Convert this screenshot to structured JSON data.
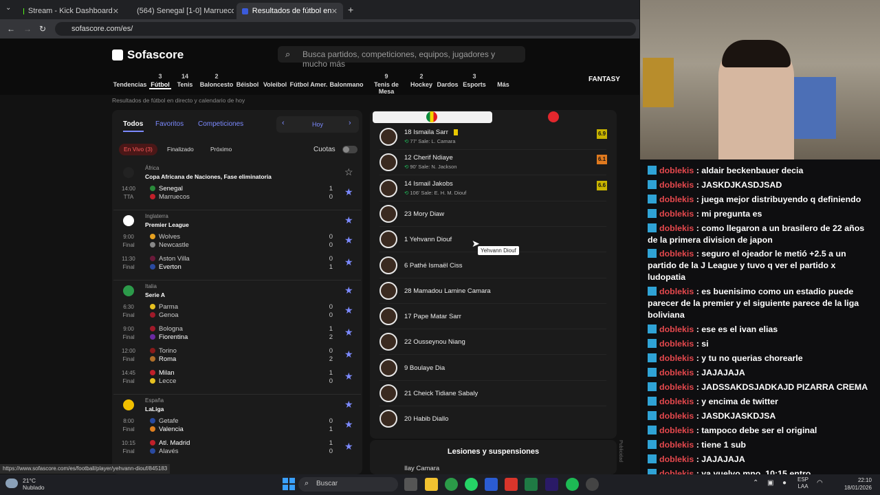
{
  "browser": {
    "tabs": [
      {
        "label": "Stream - Kick Dashboard"
      },
      {
        "label": "(564) Senegal [1-0] Marruecos |"
      },
      {
        "label": "Resultados de fútbol en directo"
      }
    ],
    "url": "sofascore.com/es/",
    "status_url": "https://www.sofascore.com/es/football/player/yehvann-diouf/845183"
  },
  "site": {
    "logo": "Sofascore",
    "search_placeholder": "Busca partidos, competiciones, equipos, jugadores y mucho más",
    "sports": [
      {
        "label": "Tendencias",
        "count": ""
      },
      {
        "label": "Fútbol",
        "count": "3"
      },
      {
        "label": "Tenis",
        "count": "14"
      },
      {
        "label": "Baloncesto",
        "count": "2"
      },
      {
        "label": "Béisbol",
        "count": ""
      },
      {
        "label": "Voleibol",
        "count": ""
      },
      {
        "label": "Fútbol Amer.",
        "count": ""
      },
      {
        "label": "Balonmano",
        "count": ""
      },
      {
        "label": "Tenis de Mesa",
        "count": "9"
      },
      {
        "label": "Hockey",
        "count": "2"
      },
      {
        "label": "Dardos",
        "count": ""
      },
      {
        "label": "Esports",
        "count": "3"
      },
      {
        "label": "Más",
        "count": ""
      }
    ],
    "fantasy": "FANTASY",
    "breadcrumb": "Resultados de fútbol en directo y calendario de hoy"
  },
  "left": {
    "tabs": [
      "Todos",
      "Favoritos",
      "Competiciones"
    ],
    "day": "Hoy",
    "filters": [
      "En Vivo (3)",
      "Finalizado",
      "Próximo"
    ],
    "odds_label": "Cuotas",
    "leagues": [
      {
        "region": "África",
        "name": "Copa Africana de Naciones, Fase eliminatoria",
        "matches": [
          {
            "time": "14:00",
            "status": "TTA",
            "home": "Senegal",
            "away": "Marruecos",
            "hs": "1",
            "as": "0"
          }
        ]
      },
      {
        "region": "Inglaterra",
        "name": "Premier League",
        "matches": [
          {
            "time": "9:00",
            "status": "Final",
            "home": "Wolves",
            "away": "Newcastle",
            "hs": "0",
            "as": "0"
          },
          {
            "time": "11:30",
            "status": "Final",
            "home": "Aston Villa",
            "away": "Everton",
            "hs": "0",
            "as": "1"
          }
        ]
      },
      {
        "region": "Italia",
        "name": "Serie A",
        "matches": [
          {
            "time": "6:30",
            "status": "Final",
            "home": "Parma",
            "away": "Genoa",
            "hs": "0",
            "as": "0"
          },
          {
            "time": "9:00",
            "status": "Final",
            "home": "Bologna",
            "away": "Fiorentina",
            "hs": "1",
            "as": "2"
          },
          {
            "time": "12:00",
            "status": "Final",
            "home": "Torino",
            "away": "Roma",
            "hs": "0",
            "as": "2"
          },
          {
            "time": "14:45",
            "status": "Final",
            "home": "Milan",
            "away": "Lecce",
            "hs": "1",
            "as": "0"
          }
        ]
      },
      {
        "region": "España",
        "name": "LaLiga",
        "matches": [
          {
            "time": "8:00",
            "status": "Final",
            "home": "Getafe",
            "away": "Valencia",
            "hs": "0",
            "as": "1"
          },
          {
            "time": "10:15",
            "status": "Final",
            "home": "Atl. Madrid",
            "away": "Alavés",
            "hs": "1",
            "as": "0"
          }
        ]
      }
    ]
  },
  "right": {
    "players": [
      {
        "name": "18 Ismaila Sarr",
        "sub": "77' Sale: L. Camara",
        "rating": "6.9",
        "rcolor": "#c9b400"
      },
      {
        "name": "12 Cherif Ndiaye",
        "sub": "90' Sale: N. Jackson",
        "rating": "6.1",
        "rcolor": "#e07a1f"
      },
      {
        "name": "14 Ismail Jakobs",
        "sub": "106' Sale: E. H. M. Diouf",
        "rating": "6.6",
        "rcolor": "#c9b400"
      },
      {
        "name": "23 Mory Diaw",
        "sub": "",
        "rating": "",
        "rcolor": ""
      },
      {
        "name": "1 Yehvann Diouf",
        "sub": "",
        "rating": "",
        "rcolor": ""
      },
      {
        "name": "6 Pathé Ismaël Ciss",
        "sub": "",
        "rating": "",
        "rcolor": ""
      },
      {
        "name": "28 Mamadou Lamine Camara",
        "sub": "",
        "rating": "",
        "rcolor": ""
      },
      {
        "name": "17 Pape Matar Sarr",
        "sub": "",
        "rating": "",
        "rcolor": ""
      },
      {
        "name": "22 Ousseynou Niang",
        "sub": "",
        "rating": "",
        "rcolor": ""
      },
      {
        "name": "9 Boulaye Dia",
        "sub": "",
        "rating": "",
        "rcolor": ""
      },
      {
        "name": "21 Cheick Tidiane Sabaly",
        "sub": "",
        "rating": "",
        "rcolor": ""
      },
      {
        "name": "20 Habib Diallo",
        "sub": "",
        "rating": "",
        "rcolor": ""
      }
    ],
    "tooltip": "Yehvann Diouf",
    "section": "Lesiones y suspensiones",
    "last": "Ilay Camara",
    "ad": "Publicidad"
  },
  "chat": [
    {
      "user": "doblekis",
      "text": "aldair beckenbauer decia"
    },
    {
      "user": "doblekis",
      "text": "JASKDJKASDJSAD"
    },
    {
      "user": "doblekis",
      "text": "juega mejor distribuyendo q definiendo"
    },
    {
      "user": "doblekis",
      "text": "mi pregunta es"
    },
    {
      "user": "doblekis",
      "text": "como llegaron a un brasilero de 22 años de la primera division de japon"
    },
    {
      "user": "doblekis",
      "text": "seguro el ojeador le metió +2.5 a un partido de la J League y tuvo q ver el partido x ludopatia"
    },
    {
      "user": "doblekis",
      "text": "es buenisimo como un estadio puede parecer de la premier y el siguiente parece de la liga boliviana"
    },
    {
      "user": "doblekis",
      "text": "ese es el ivan elias"
    },
    {
      "user": "doblekis",
      "text": "si"
    },
    {
      "user": "doblekis",
      "text": "y tu no querias chorearle"
    },
    {
      "user": "doblekis",
      "text": "JAJAJAJA"
    },
    {
      "user": "doblekis",
      "text": "JADSSAKDSJADKAJD PIZARRA CREMA"
    },
    {
      "user": "doblekis",
      "text": "y encima de twitter"
    },
    {
      "user": "doblekis",
      "text": "JASDKJASKDJSA"
    },
    {
      "user": "doblekis",
      "text": "tampoco debe ser el original"
    },
    {
      "user": "doblekis",
      "text": "tiene 1 sub"
    },
    {
      "user": "doblekis",
      "text": "JAJAJAJA"
    },
    {
      "user": "doblekis",
      "text": "ya vuelvo mno, 10:15 entro"
    }
  ],
  "taskbar": {
    "temp": "21°C",
    "weather": "Nublado",
    "search": "Buscar",
    "lang1": "ESP",
    "lang2": "LAA",
    "time": "22:10",
    "date": "18/01/2026"
  }
}
